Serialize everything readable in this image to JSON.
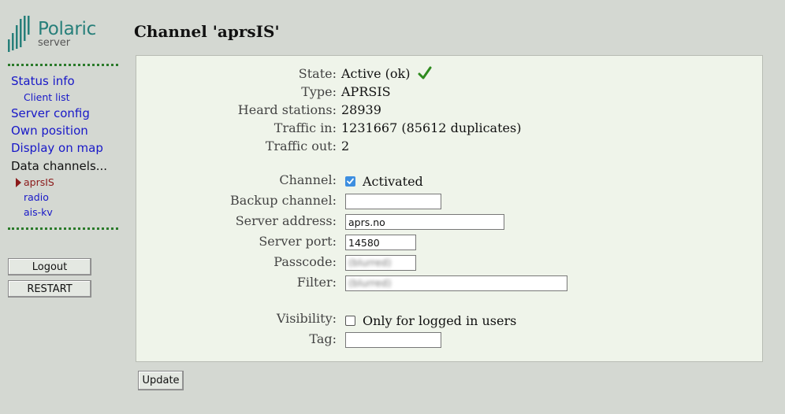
{
  "logo": {
    "name": "Polaric",
    "sub": "server"
  },
  "nav": {
    "status_info": "Status info",
    "client_list": "Client list",
    "server_config": "Server config",
    "own_position": "Own position",
    "display_on_map": "Display on map",
    "data_channels": "Data channels...",
    "channels": [
      "aprsIS",
      "radio",
      "ais-kv"
    ]
  },
  "buttons": {
    "logout": "Logout",
    "restart": "RESTART",
    "update": "Update"
  },
  "page_title": "Channel 'aprsIS'",
  "status": {
    "state_label": "State:",
    "state_value": "Active (ok)",
    "state_icon": "checkmark-icon",
    "type_label": "Type:",
    "type_value": "APRSIS",
    "heard_label": "Heard stations:",
    "heard_value": "28939",
    "traffic_in_label": "Traffic in:",
    "traffic_in_value": "1231667 (85612 duplicates)",
    "traffic_out_label": "Traffic out:",
    "traffic_out_value": "2"
  },
  "form": {
    "channel_label": "Channel:",
    "channel_checkbox": "Activated",
    "backup_label": "Backup channel:",
    "backup_value": "",
    "server_address_label": "Server address:",
    "server_address_value": "aprs.no",
    "server_port_label": "Server port:",
    "server_port_value": "14580",
    "passcode_label": "Passcode:",
    "passcode_value": "(blurred)",
    "filter_label": "Filter:",
    "filter_value": "(blurred)",
    "visibility_label": "Visibility:",
    "visibility_checkbox": "Only for logged in users",
    "tag_label": "Tag:",
    "tag_value": ""
  },
  "colors": {
    "accent_green": "#2a7a2a",
    "logo_teal": "#277f7a",
    "link_blue": "#1818c8",
    "active_red": "#8b1a1a"
  }
}
